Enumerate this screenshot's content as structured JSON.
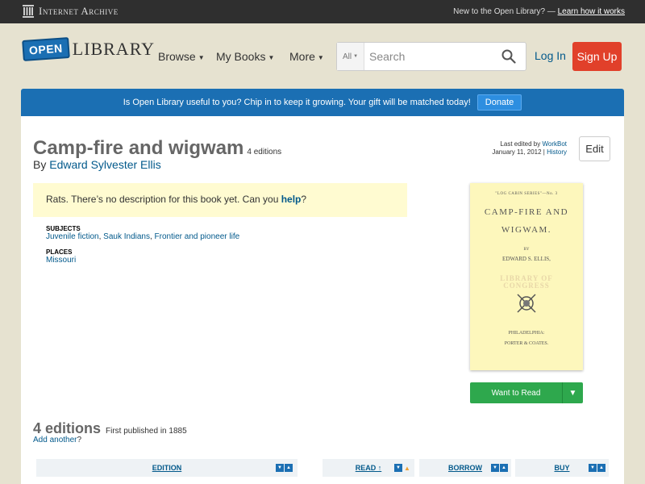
{
  "ia_bar": {
    "logo_text": "Internet Archive",
    "new_text": "New to the Open Library? — ",
    "learn_link": "Learn how it works"
  },
  "header": {
    "logo_open": "OPEN",
    "logo_library": "LIBRARY",
    "nav": [
      "Browse",
      "My Books",
      "More"
    ],
    "search_scope": "All",
    "search_placeholder": "Search",
    "login": "Log In",
    "signup": "Sign Up"
  },
  "banner": {
    "text": "Is Open Library useful to you? Chip in to keep it growing. Your gift will be matched today!",
    "donate": "Donate"
  },
  "work": {
    "title": "Camp-fire and wigwam",
    "editions_count": "4 editions",
    "by": "By ",
    "author": "Edward Sylvester Ellis",
    "last_edited_prefix": "Last edited by ",
    "last_edited_user": "WorkBot",
    "last_edited_date": "January 11, 2012 | ",
    "history": "History",
    "edit": "Edit",
    "desc_prefix": "Rats. There’s no description for this book yet. Can you ",
    "desc_link": "help",
    "desc_suffix": "?",
    "subjects_label": "SUBJECTS",
    "subjects": [
      "Juvenile fiction",
      "Sauk Indians",
      "Frontier and pioneer life"
    ],
    "places_label": "PLACES",
    "places": [
      "Missouri"
    ]
  },
  "cover": {
    "series": "\"LOG CABIN SERIES\"—No. 3",
    "title_line1": "CAMP-FIRE AND",
    "title_line2": "WIGWAM.",
    "by": "BY",
    "author": "EDWARD S. ELLIS,",
    "stamp_line1": "LIBRARY OF",
    "stamp_line2": "CONGRESS",
    "city": "PHILADELPHIA:",
    "publisher": "PORTER & COATES."
  },
  "want_to_read": "Want to Read",
  "editions_section": {
    "heading": "4 editions",
    "first_published": "First published in 1885",
    "add_another": "Add another",
    "add_suffix": "?",
    "columns": [
      "EDITION",
      "READ ↑",
      "BORROW",
      "BUY"
    ]
  }
}
